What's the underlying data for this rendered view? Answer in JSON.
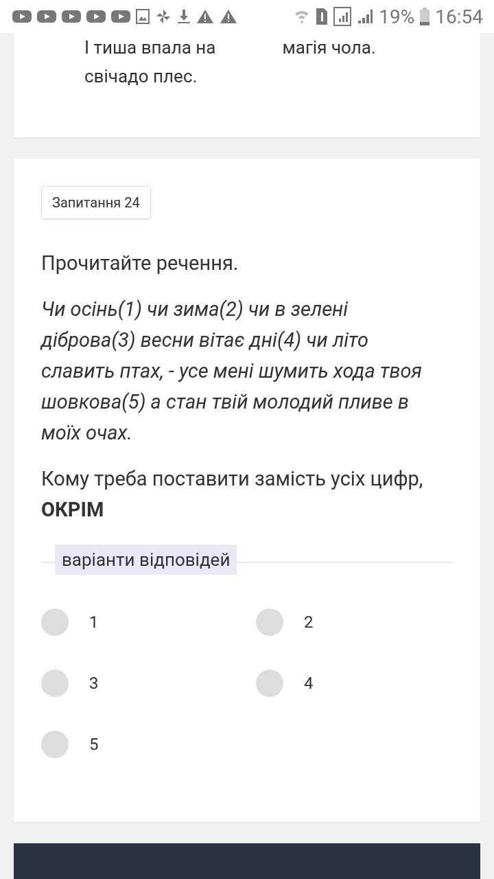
{
  "status_bar": {
    "battery": "19%",
    "time": "16:54"
  },
  "previous_card": {
    "columns": [
      [
        "І тиша впала на",
        "свічадо плес."
      ],
      [
        "магія чола."
      ]
    ]
  },
  "question": {
    "badge": "Запитання 24",
    "instruction": "Прочитайте речення.",
    "sentence": "Чи осінь(1) чи зима(2) чи в зелені діброва(3) весни вітає дні(4) чи літо славить птах, - усе мені шумить хода твоя шовкова(5) а стан твій молодий пливе в моїх очах.",
    "prompt": "Кому треба поставити замість усіх цифр, **ОКРІМ**",
    "options_label": "варіанти відповідей",
    "options": [
      {
        "label": "1",
        "selected": false
      },
      {
        "label": "2",
        "selected": false
      },
      {
        "label": "3",
        "selected": false
      },
      {
        "label": "4",
        "selected": false
      },
      {
        "label": "5",
        "selected": false
      }
    ]
  }
}
